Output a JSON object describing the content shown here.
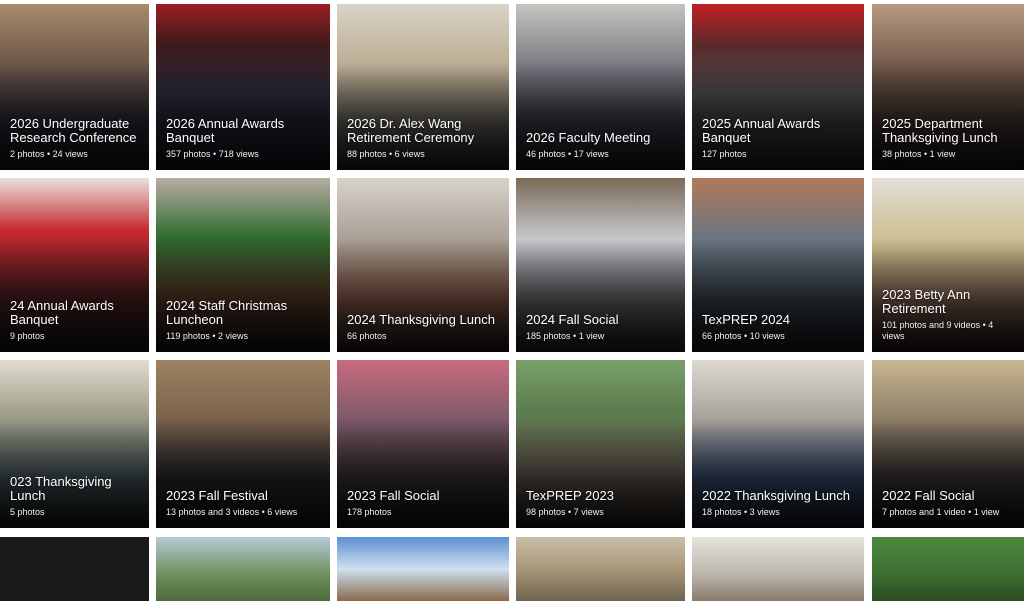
{
  "gallery": {
    "albums": [
      {
        "title": "2026 Undergraduate\nResearch Conference",
        "meta": "2 photos • 24 views"
      },
      {
        "title": "2026 Annual Awards\nBanquet",
        "meta": "357 photos • 718 views"
      },
      {
        "title": "2026 Dr. Alex Wang\nRetirement Ceremony",
        "meta": "88 photos • 6 views"
      },
      {
        "title": "2026 Faculty Meeting",
        "meta": "46 photos • 17 views"
      },
      {
        "title": "2025 Annual Awards\nBanquet",
        "meta": "127 photos"
      },
      {
        "title": "2025 Department\nThanksgiving Lunch",
        "meta": "38 photos • 1 view"
      },
      {
        "title": "24 Annual Awards\nBanquet",
        "meta": "9 photos"
      },
      {
        "title": "2024 Staff Christmas\nLuncheon",
        "meta": "119 photos • 2 views"
      },
      {
        "title": "2024 Thanksgiving Lunch",
        "meta": "66 photos"
      },
      {
        "title": "2024 Fall Social",
        "meta": "185 photos • 1 view"
      },
      {
        "title": "TexPREP 2024",
        "meta": "66 photos • 10 views"
      },
      {
        "title": "2023 Betty Ann\nRetirement",
        "meta": "101 photos and 9 videos • 4 views"
      },
      {
        "title": "023 Thanksgiving Lunch",
        "meta": "5 photos"
      },
      {
        "title": "2023 Fall Festival",
        "meta": "13 photos and 3 videos • 6 views"
      },
      {
        "title": "2023 Fall Social",
        "meta": "178 photos"
      },
      {
        "title": "TexPREP 2023",
        "meta": "98 photos • 7 views"
      },
      {
        "title": "2022 Thanksgiving Lunch",
        "meta": "18 photos • 3 views"
      },
      {
        "title": "2022 Fall Social",
        "meta": "7 photos and 1 video • 1 view"
      }
    ]
  }
}
